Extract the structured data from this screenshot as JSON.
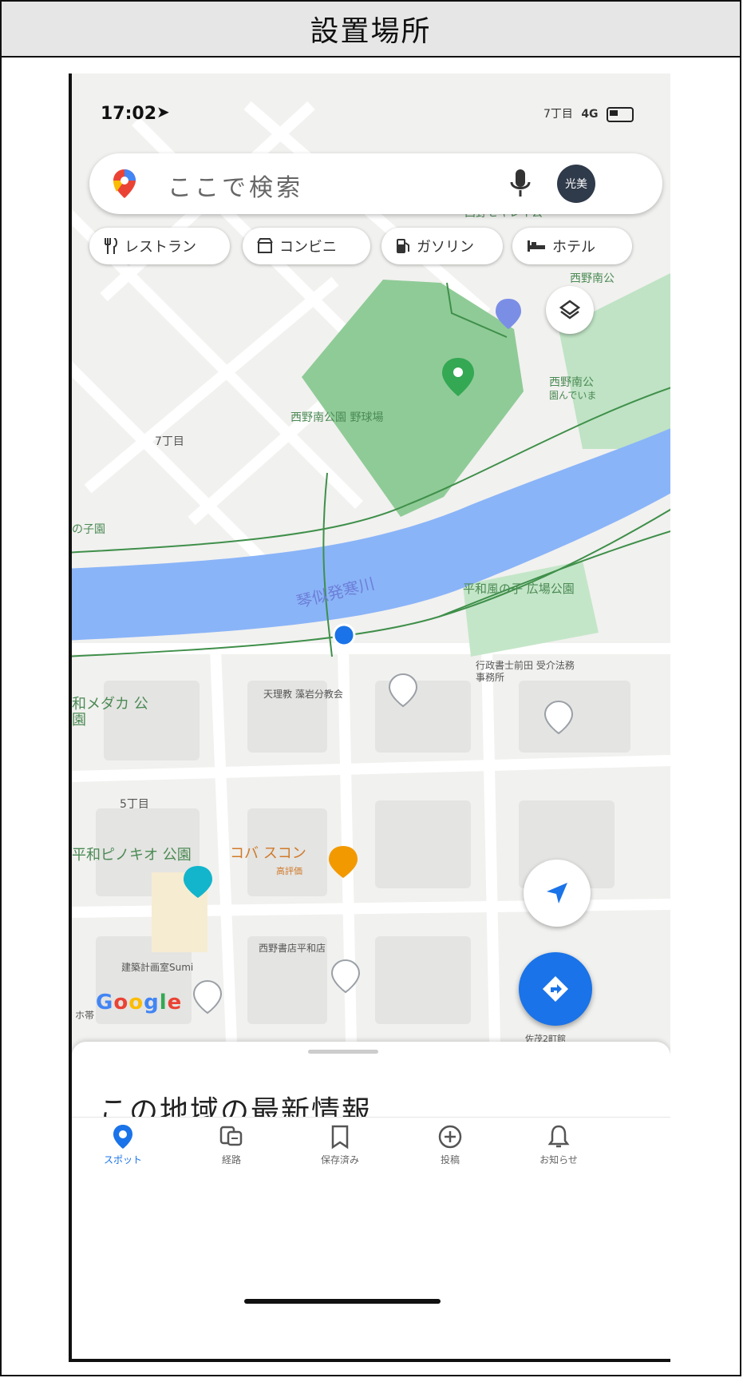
{
  "caption": "設置場所",
  "status": {
    "time": "17:02",
    "location_text": "7丁目",
    "network": "4G"
  },
  "search": {
    "placeholder": "ここで検索",
    "avatar_text": "光美"
  },
  "chips": [
    {
      "label": "レストラン",
      "icon": "restaurant-icon"
    },
    {
      "label": "コンビニ",
      "icon": "convenience-store-icon"
    },
    {
      "label": "ガソリン",
      "icon": "gas-station-icon"
    },
    {
      "label": "ホテル",
      "icon": "hotel-icon"
    }
  ],
  "map_labels": {
    "park_top": "西野南公",
    "park_top_partial": "西野セキレイ公",
    "park_right": "西野南公",
    "park_right_sub": "園んでいま",
    "park_main": "西野南公園 野球場",
    "district_7": "7丁目",
    "left_park": "の子園",
    "river": "琴似発寒川",
    "heiwa_park": "平和風の子 広場公園",
    "office": "行政書士前田 受介法務事務所",
    "church": "天理教 藻岩分教会",
    "medaka_park": "和メダカ 公園",
    "district_5": "5丁目",
    "pinocchio_park": "平和ピノキオ 公園",
    "cafe": "コバ スコン",
    "cafe_sub": "高評価",
    "bookstore": "西野書店平和店",
    "architect": "建築計画室Sumi",
    "left_bottom": "ホ帯",
    "bottom_right": "佐茂2町館"
  },
  "google_logo": "Google",
  "sheet_title": "この地域の最新情報",
  "nav": [
    {
      "label": "スポット",
      "icon": "location-pin-icon",
      "active": true
    },
    {
      "label": "経路",
      "icon": "commute-icon",
      "active": false
    },
    {
      "label": "保存済み",
      "icon": "bookmark-icon",
      "active": false
    },
    {
      "label": "投稿",
      "icon": "add-circle-icon",
      "active": false
    },
    {
      "label": "お知らせ",
      "icon": "bell-icon",
      "active": false
    }
  ],
  "colors": {
    "accent": "#1a73e8",
    "river": "#8ab4f8",
    "park": "#8fcb97",
    "park_pin": "#34a853",
    "restaurant_pin": "#f29900",
    "school_pin": "#12b5cb",
    "poi_pin": "#7b8ee6"
  }
}
